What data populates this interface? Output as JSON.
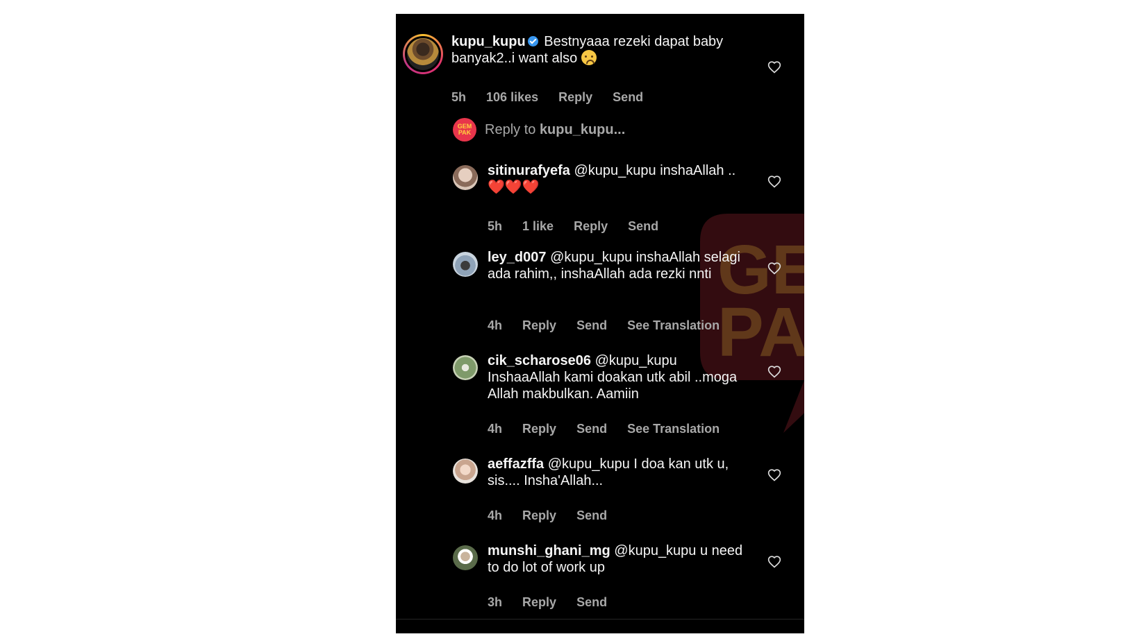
{
  "main_comment": {
    "username": "kupu_kupu",
    "text": "Bestnyaaa rezeki dapat baby banyak2..i want also",
    "emoji": "crying-face",
    "time": "5h",
    "likes": "106 likes",
    "reply": "Reply",
    "send": "Send"
  },
  "reply_prompt": {
    "avatar_text": "GEM PAK",
    "prefix": "Reply to",
    "target": "kupu_kupu..."
  },
  "replies": [
    {
      "username": "sitinurafyefa",
      "text": "@kupu_kupu inshaAllah ..",
      "hearts": "❤️❤️❤️",
      "time": "5h",
      "likes": "1 like",
      "reply": "Reply",
      "send": "Send",
      "translate": ""
    },
    {
      "username": "ley_d007",
      "text": "@kupu_kupu inshaAllah selagi ada rahim,, inshaAllah ada rezki nnti",
      "hearts": "",
      "time": "4h",
      "likes": "",
      "reply": "Reply",
      "send": "Send",
      "translate": "See Translation"
    },
    {
      "username": "cik_scharose06",
      "text": "@kupu_kupu InshaaAllah kami doakan utk abil ..moga Allah makbulkan. Aamiin",
      "hearts": "",
      "time": "4h",
      "likes": "",
      "reply": "Reply",
      "send": "Send",
      "translate": "See Translation"
    },
    {
      "username": "aeffazffa",
      "text": "@kupu_kupu I doa kan utk u, sis.... Insha'Allah...",
      "hearts": "",
      "time": "4h",
      "likes": "",
      "reply": "Reply",
      "send": "Send",
      "translate": ""
    },
    {
      "username": "munshi_ghani_mg",
      "text": "@kupu_kupu u need to do lot of work up",
      "hearts": "",
      "time": "3h",
      "likes": "",
      "reply": "Reply",
      "send": "Send",
      "translate": ""
    }
  ],
  "watermark": {
    "line1": "GEM",
    "line2": "PAK"
  },
  "colors": {
    "background": "#000000",
    "text": "#f5f5f5",
    "meta": "#a8a8a8",
    "accent": "#e8354b"
  }
}
